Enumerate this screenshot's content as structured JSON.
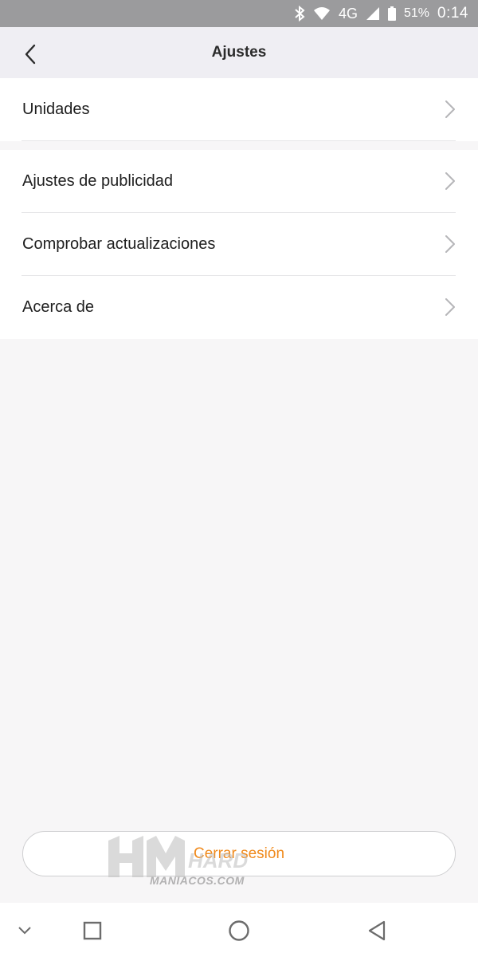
{
  "status_bar": {
    "network": "4G",
    "battery": "51%",
    "time": "0:14",
    "icons": [
      "bluetooth-icon",
      "wifi-icon",
      "signal-icon",
      "battery-icon"
    ]
  },
  "header": {
    "title": "Ajustes",
    "back_icon": "chevron-left-icon"
  },
  "settings": {
    "group1": [
      {
        "label": "Unidades"
      }
    ],
    "group2": [
      {
        "label": "Ajustes de publicidad"
      },
      {
        "label": "Comprobar actualizaciones"
      },
      {
        "label": "Acerca de"
      }
    ]
  },
  "logout": {
    "label": "Cerrar sesión"
  },
  "watermark": {
    "text": "MANIACOS.COM"
  },
  "nav_bar": {
    "icons": [
      "hide-keyboard-icon",
      "recents-icon",
      "home-icon",
      "back-icon"
    ]
  },
  "colors": {
    "accent": "#f08a1c",
    "status_bar": "#9b9b9d",
    "header_bg": "#efeef3",
    "page_bg": "#f7f6f7"
  }
}
